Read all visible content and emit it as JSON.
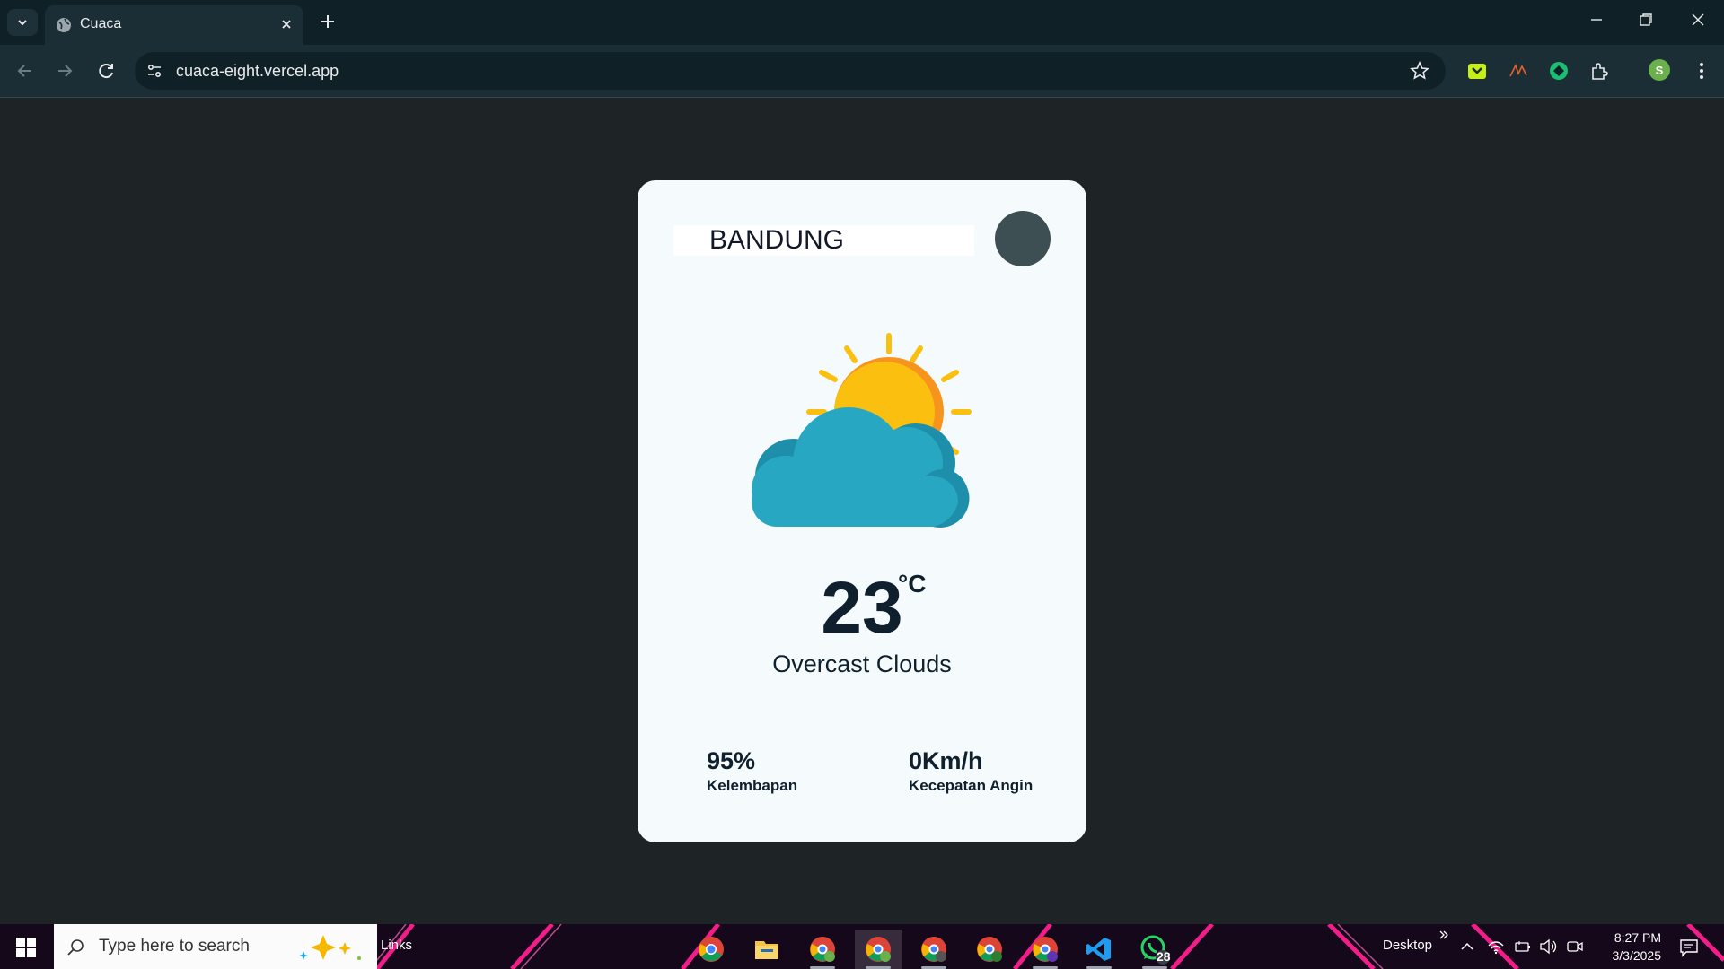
{
  "browser": {
    "tab_title": "Cuaca",
    "url": "cuaca-eight.vercel.app",
    "profile_initial": "S"
  },
  "weather": {
    "city": "BANDUNG",
    "icon": "sun-behind-cloud-icon",
    "temperature": "23",
    "unit": "°C",
    "description": "Overcast Clouds",
    "humidity_value": "95%",
    "humidity_label": "Kelembapan",
    "wind_value": "0Km/h",
    "wind_label": "Kecepatan Angin"
  },
  "taskbar": {
    "search_placeholder": "Type here to search",
    "links_label": "Links",
    "desktop_label": "Desktop",
    "whatsapp_badge": "28",
    "time": "8:27 PM",
    "date": "3/3/2025"
  },
  "colors": {
    "page_bg": "#1e2326",
    "card_bg": "#f5fbfc",
    "text_dark": "#0f1f2e",
    "search_button": "#3d4f53",
    "sun": "#fbbf0f",
    "cloud": "#28a7c2"
  }
}
